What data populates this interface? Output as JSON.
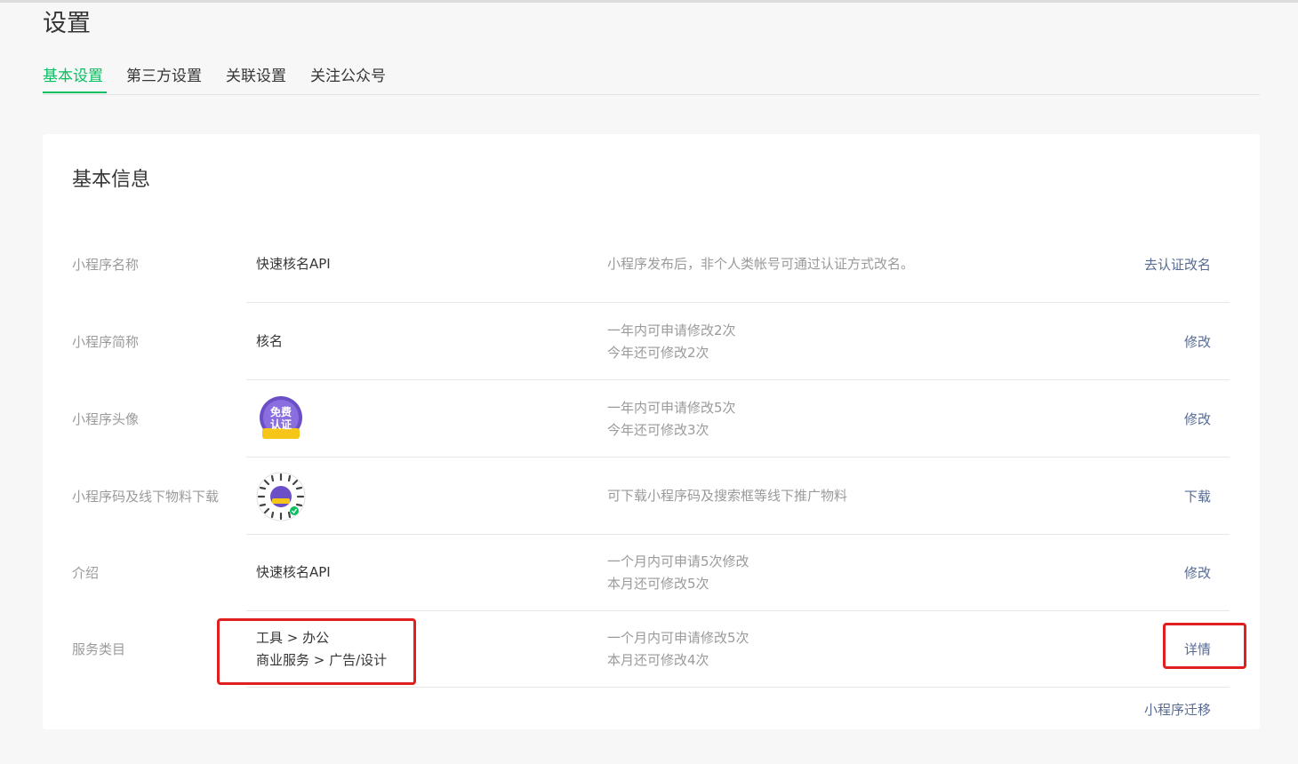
{
  "page": {
    "title": "设置"
  },
  "tabs": [
    {
      "label": "基本设置",
      "active": true
    },
    {
      "label": "第三方设置",
      "active": false
    },
    {
      "label": "关联设置",
      "active": false
    },
    {
      "label": "关注公众号",
      "active": false
    }
  ],
  "card": {
    "title": "基本信息"
  },
  "rows": {
    "name": {
      "label": "小程序名称",
      "value": "快速核名API",
      "desc1": "小程序发布后，非个人类帐号可通过认证方式改名。",
      "action": "去认证改名"
    },
    "short_name": {
      "label": "小程序简称",
      "value": "核名",
      "desc1": "一年内可申请修改2次",
      "desc2": "今年还可修改2次",
      "action": "修改"
    },
    "avatar": {
      "label": "小程序头像",
      "badge_text_top": "免费",
      "badge_text_bottom": "认证",
      "desc1": "一年内可申请修改5次",
      "desc2": "今年还可修改3次",
      "action": "修改"
    },
    "qrcode": {
      "label": "小程序码及线下物料下载",
      "desc1": "可下载小程序码及搜索框等线下推广物料",
      "action": "下载"
    },
    "intro": {
      "label": "介绍",
      "value": "快速核名API",
      "desc1": "一个月内可申请5次修改",
      "desc2": "本月还可修改5次",
      "action": "修改"
    },
    "category": {
      "label": "服务类目",
      "value1": "工具 > 办公",
      "value2": "商业服务 > 广告/设计",
      "desc1": "一个月内可申请修改5次",
      "desc2": "本月还可修改4次",
      "action": "详情"
    },
    "migrate": {
      "action": "小程序迁移"
    }
  },
  "colors": {
    "accent": "#07c160",
    "link": "#576b95",
    "highlight": "#e02020",
    "avatar_purple": "#6a4fc6",
    "avatar_gold": "#f5c518"
  }
}
